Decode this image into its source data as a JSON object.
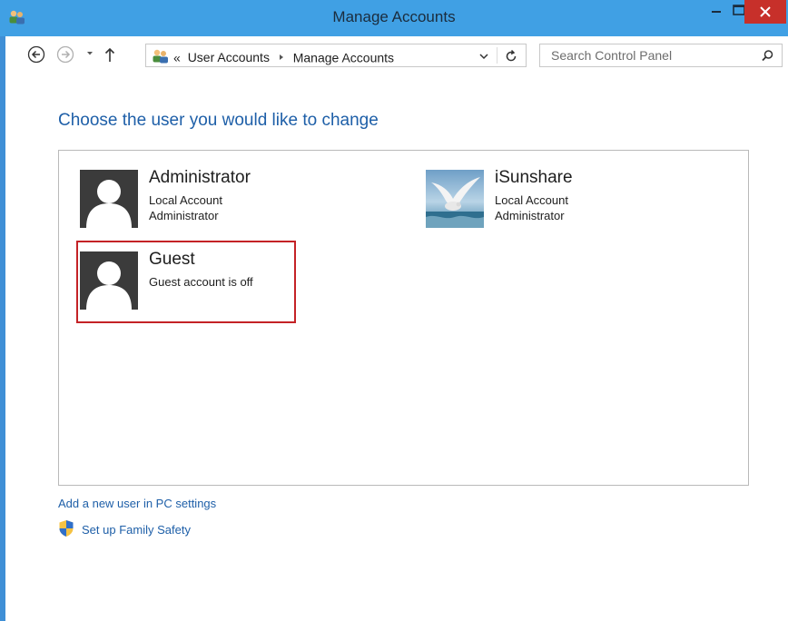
{
  "window": {
    "title": "Manage Accounts",
    "controls": {
      "minimize": "minimize",
      "maximize": "maximize",
      "close": "close"
    }
  },
  "address_bar": {
    "separator": "«",
    "crumbs": [
      "User Accounts",
      "Manage Accounts"
    ],
    "search_placeholder": "Search Control Panel"
  },
  "main": {
    "heading": "Choose the user you would like to change",
    "accounts": [
      {
        "name": "Administrator",
        "line1": "Local Account",
        "line2": "Administrator",
        "picture": "default-user-icon"
      },
      {
        "name": "iSunshare",
        "line1": "Local Account",
        "line2": "Administrator",
        "picture": "seagull-photo"
      },
      {
        "name": "Guest",
        "line1": "Guest account is off",
        "line2": "",
        "picture": "default-user-icon",
        "highlighted": true
      }
    ]
  },
  "links": {
    "add_user": "Add a new user in PC settings",
    "family_safety": "Set up Family Safety"
  },
  "colors": {
    "titlebar": "#40a0e4",
    "heading": "#1e5fa8",
    "close_button": "#c7302a",
    "highlight_border": "#c42226"
  }
}
